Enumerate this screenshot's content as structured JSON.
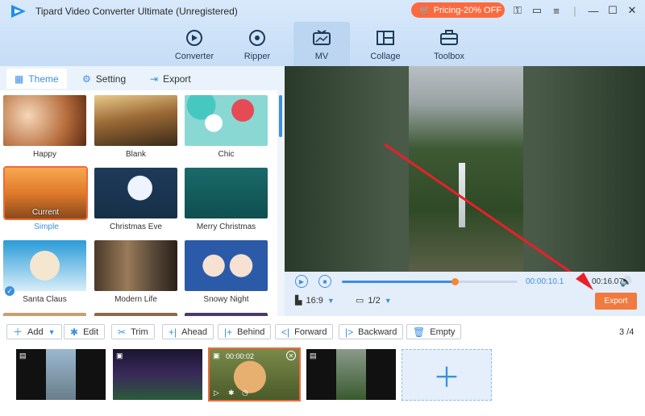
{
  "app": {
    "title": "Tipard Video Converter Ultimate (Unregistered)",
    "pricing": "Pricing-20% OFF"
  },
  "nav": [
    {
      "label": "Converter"
    },
    {
      "label": "Ripper"
    },
    {
      "label": "MV"
    },
    {
      "label": "Collage"
    },
    {
      "label": "Toolbox"
    }
  ],
  "tabs": [
    {
      "label": "Theme"
    },
    {
      "label": "Setting"
    },
    {
      "label": "Export"
    }
  ],
  "themes": [
    {
      "label": "Happy"
    },
    {
      "label": "Blank"
    },
    {
      "label": "Chic"
    },
    {
      "label": "Simple"
    },
    {
      "label": "Christmas Eve"
    },
    {
      "label": "Merry Christmas"
    },
    {
      "label": "Santa Claus"
    },
    {
      "label": "Modern Life"
    },
    {
      "label": "Snowy Night"
    }
  ],
  "current_label": "Current",
  "player": {
    "time_current": "00:00:10.1",
    "time_total": "00:16.07",
    "progress": 0.64,
    "aspect": "16:9",
    "page": "1/2",
    "export_label": "Export"
  },
  "toolbar": {
    "add": "Add",
    "edit": "Edit",
    "trim": "Trim",
    "ahead": "Ahead",
    "behind": "Behind",
    "forward": "Forward",
    "backward": "Backward",
    "empty": "Empty",
    "count": "3 /4"
  },
  "clips": [
    {
      "time": ""
    },
    {
      "time": ""
    },
    {
      "time": "00:00:02"
    },
    {
      "time": ""
    }
  ],
  "colors": {
    "accent": "#3b8fe0",
    "export": "#f07a3f",
    "pricing": "#fb6a3e",
    "arrow": "#e8202a"
  }
}
